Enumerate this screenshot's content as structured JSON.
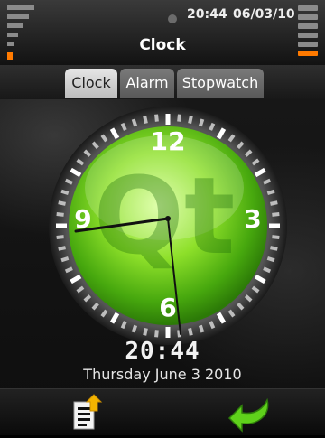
{
  "status_bar": {
    "time": "20:44",
    "date": "06/03/10"
  },
  "app": {
    "title": "Clock"
  },
  "tabs": [
    {
      "label": "Clock",
      "active": true
    },
    {
      "label": "Alarm",
      "active": false
    },
    {
      "label": "Stopwatch",
      "active": false
    }
  ],
  "clock_face": {
    "numerals": [
      "12",
      "3",
      "6",
      "9"
    ],
    "watermark": "Qt",
    "time_shown": "20:44",
    "hour": 8,
    "minute": 44
  },
  "digital_time": "20:44",
  "date_text": "Thursday June 3 2010",
  "toolbar": {
    "left_icon": "menu-document-icon",
    "right_icon": "back-arrow-icon"
  },
  "colors": {
    "accent_green": "#5fd11b",
    "battery_orange": "#ff7a00"
  }
}
